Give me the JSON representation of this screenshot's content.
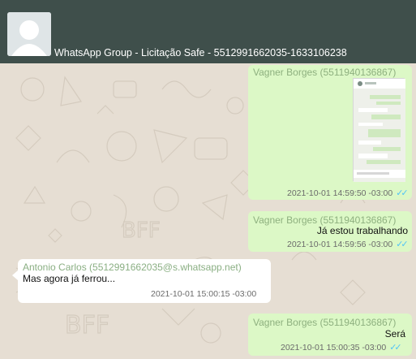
{
  "header": {
    "title": "WhatsApp Group - Licitação Safe - 5512991662035-1633106238"
  },
  "messages": [
    {
      "sender": "Vagner Borges (5511940136867)",
      "text": "",
      "time": "2021-10-01 14:59:50 -03:00",
      "ticks": "✓✓",
      "has_image": true
    },
    {
      "sender": "Vagner Borges (5511940136867)",
      "text": "Já estou trabalhando",
      "time": "2021-10-01 14:59:56 -03:00",
      "ticks": "✓✓"
    },
    {
      "sender": "Antonio Carlos (5512991662035@s.whatsapp.net)",
      "text": "Mas agora já ferrou...",
      "time": "2021-10-01 15:00:15 -03:00"
    },
    {
      "sender": "Vagner Borges (5511940136867)",
      "text": "Será",
      "time": "2021-10-01 15:00:35 -03:00",
      "ticks": "✓✓"
    }
  ],
  "colors": {
    "header_bg": "#3f4f4b",
    "outgoing_bubble": "#dcf8c6",
    "incoming_bubble": "#ffffff",
    "sender_text": "#8eb07f",
    "read_ticks": "#4fc3f7"
  },
  "icons": {
    "avatar": "default-user-avatar",
    "ticks": "double-check-icon"
  }
}
